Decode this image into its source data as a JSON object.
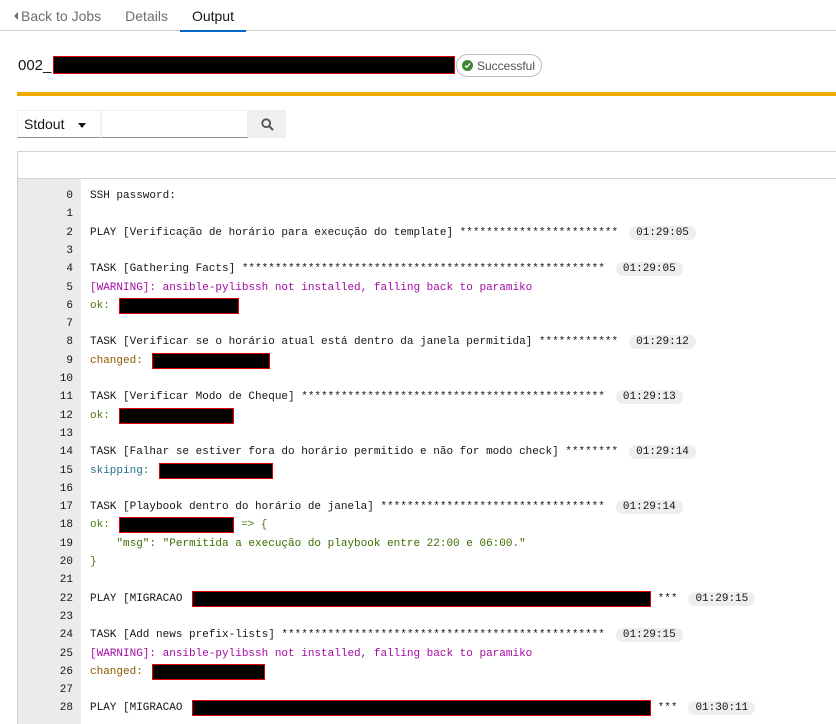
{
  "tabs": {
    "back": "Back to Jobs",
    "details": "Details",
    "output": "Output"
  },
  "job": {
    "title_prefix": "002_",
    "status": "Successful"
  },
  "toolbar": {
    "filter_selected": "Stdout",
    "search_placeholder": ""
  },
  "colors": {
    "accent_bar": "#f0ab00",
    "success": "#3e8635",
    "warning_text": "#a30aa3",
    "ok_text": "#4a7c0f",
    "changed_text": "#8a5a00",
    "skipping_text": "#1f6f8b"
  },
  "output_lines": [
    {
      "n": "0",
      "parts": [
        {
          "t": "SSH password:",
          "c": ""
        }
      ]
    },
    {
      "n": "1",
      "parts": []
    },
    {
      "n": "2",
      "parts": [
        {
          "t": "PLAY [Verificação de horário para execução do template] ************************",
          "c": ""
        }
      ],
      "ts": "01:29:05"
    },
    {
      "n": "3",
      "parts": []
    },
    {
      "n": "4",
      "parts": [
        {
          "t": "TASK [Gathering Facts] *******************************************************",
          "c": ""
        }
      ],
      "ts": "01:29:05"
    },
    {
      "n": "5",
      "parts": [
        {
          "t": "[WARNING]: ansible-pylibssh not installed, falling back to paramiko",
          "c": "c-warn"
        }
      ]
    },
    {
      "n": "6",
      "parts": [
        {
          "t": "ok: ",
          "c": "c-ok"
        },
        {
          "redact": 120
        }
      ]
    },
    {
      "n": "7",
      "parts": []
    },
    {
      "n": "8",
      "parts": [
        {
          "t": "TASK [Verificar se o horário atual está dentro da janela permitida] ************",
          "c": ""
        }
      ],
      "ts": "01:29:12"
    },
    {
      "n": "9",
      "parts": [
        {
          "t": "changed: ",
          "c": "c-changed"
        },
        {
          "redact": 118
        }
      ]
    },
    {
      "n": "10",
      "parts": []
    },
    {
      "n": "11",
      "parts": [
        {
          "t": "TASK [Verificar Modo de Cheque] **********************************************",
          "c": ""
        }
      ],
      "ts": "01:29:13"
    },
    {
      "n": "12",
      "parts": [
        {
          "t": "ok: ",
          "c": "c-ok"
        },
        {
          "redact": 115
        }
      ]
    },
    {
      "n": "13",
      "parts": []
    },
    {
      "n": "14",
      "parts": [
        {
          "t": "TASK [Falhar se estiver fora do horário permitido e não for modo check] ********",
          "c": ""
        }
      ],
      "ts": "01:29:14"
    },
    {
      "n": "15",
      "parts": [
        {
          "t": "skipping: ",
          "c": "c-skip"
        },
        {
          "redact": 114
        }
      ]
    },
    {
      "n": "16",
      "parts": []
    },
    {
      "n": "17",
      "parts": [
        {
          "t": "TASK [Playbook dentro do horário de janela] **********************************",
          "c": ""
        }
      ],
      "ts": "01:29:14"
    },
    {
      "n": "18",
      "parts": [
        {
          "t": "ok: ",
          "c": "c-ok"
        },
        {
          "redact": 115
        },
        {
          "t": " => {",
          "c": "c-ok"
        }
      ]
    },
    {
      "n": "19",
      "parts": [
        {
          "t": "    \"msg\": \"Permitida a execução do playbook entre 22:00 e 06:00.\"",
          "c": "c-msg"
        }
      ]
    },
    {
      "n": "20",
      "parts": [
        {
          "t": "}",
          "c": "c-ok"
        }
      ]
    },
    {
      "n": "21",
      "parts": []
    },
    {
      "n": "22",
      "parts": [
        {
          "t": "PLAY [MIGRACAO ",
          "c": ""
        },
        {
          "redact": 459
        },
        {
          "t": " ***",
          "c": ""
        }
      ],
      "ts": "01:29:15"
    },
    {
      "n": "23",
      "parts": []
    },
    {
      "n": "24",
      "parts": [
        {
          "t": "TASK [Add news prefix-lists] *************************************************",
          "c": ""
        }
      ],
      "ts": "01:29:15"
    },
    {
      "n": "25",
      "parts": [
        {
          "t": "[WARNING]: ansible-pylibssh not installed, falling back to paramiko",
          "c": "c-warn"
        }
      ]
    },
    {
      "n": "26",
      "parts": [
        {
          "t": "changed: ",
          "c": "c-changed"
        },
        {
          "redact": 113
        }
      ]
    },
    {
      "n": "27",
      "parts": []
    },
    {
      "n": "28",
      "parts": [
        {
          "t": "PLAY [MIGRACAO ",
          "c": ""
        },
        {
          "redact": 459
        },
        {
          "t": " ***",
          "c": ""
        }
      ],
      "ts": "01:30:11"
    }
  ]
}
